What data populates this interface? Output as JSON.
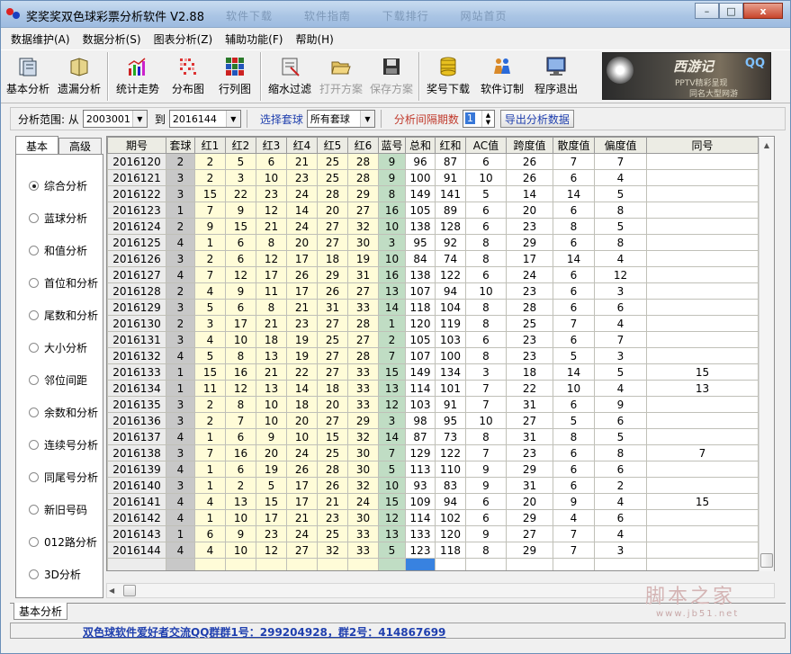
{
  "window": {
    "title": "奖奖奖双色球彩票分析软件 V2.88",
    "ghost_tabs": [
      "软件下载",
      "软件指南",
      "下载排行",
      "网站首页"
    ],
    "controls": {
      "minimize": "–",
      "maximize": "□",
      "close": "x"
    }
  },
  "menu": [
    "数据维护(A)",
    "数据分析(S)",
    "图表分析(Z)",
    "辅助功能(F)",
    "帮助(H)"
  ],
  "toolbar": {
    "groups": [
      [
        {
          "label": "基本分析",
          "icon": "basic-analysis-icon"
        },
        {
          "label": "遗漏分析",
          "icon": "omission-icon"
        }
      ],
      [
        {
          "label": "统计走势",
          "icon": "trend-chart-icon"
        },
        {
          "label": "分布图",
          "icon": "distribution-icon"
        },
        {
          "label": "行列图",
          "icon": "row-column-icon"
        }
      ],
      [
        {
          "label": "缩水过滤",
          "icon": "filter-icon"
        },
        {
          "label": "打开方案",
          "icon": "open-folder-icon",
          "disabled": true
        },
        {
          "label": "保存方案",
          "icon": "floppy-disk-icon",
          "disabled": true
        }
      ],
      [
        {
          "label": "奖号下载",
          "icon": "coin-stack-icon"
        },
        {
          "label": "软件订制",
          "icon": "people-icon"
        },
        {
          "label": "程序退出",
          "icon": "monitor-exit-icon"
        }
      ]
    ],
    "banner": {
      "title": "西游记",
      "qq": "QQ",
      "line1": "PPTV精彩呈现",
      "line2": "同名大型网游"
    }
  },
  "filter": {
    "range_label": "分析范围: 从",
    "from": "2003001",
    "to_label": "到",
    "to": "2016144",
    "select_label": "选择套球",
    "select_value": "所有套球",
    "interval_label": "分析间隔期数",
    "interval_value": "1",
    "export_label": "导出分析数据"
  },
  "left_tabs": [
    "基本",
    "高级"
  ],
  "analysis_options": [
    {
      "label": "综合分析",
      "selected": true
    },
    {
      "label": "蓝球分析",
      "selected": false
    },
    {
      "label": "和值分析",
      "selected": false
    },
    {
      "label": "首位和分析",
      "selected": false
    },
    {
      "label": "尾数和分析",
      "selected": false
    },
    {
      "label": "大小分析",
      "selected": false
    },
    {
      "label": "邻位间距",
      "selected": false
    },
    {
      "label": "余数和分析",
      "selected": false
    },
    {
      "label": "连续号分析",
      "selected": false
    },
    {
      "label": "同尾号分析",
      "selected": false
    },
    {
      "label": "新旧号码",
      "selected": false
    },
    {
      "label": "012路分析",
      "selected": false
    },
    {
      "label": "3D分析",
      "selected": false
    }
  ],
  "table": {
    "columns": [
      "期号",
      "套球",
      "红1",
      "红2",
      "红3",
      "红4",
      "红5",
      "红6",
      "蓝号",
      "总和",
      "红和",
      "AC值",
      "跨度值",
      "散度值",
      "偏度值",
      "同号"
    ],
    "rows": [
      [
        "2016120",
        "2",
        "2",
        "5",
        "6",
        "21",
        "25",
        "28",
        "9",
        "96",
        "87",
        "6",
        "26",
        "7",
        "7",
        ""
      ],
      [
        "2016121",
        "3",
        "2",
        "3",
        "10",
        "23",
        "25",
        "28",
        "9",
        "100",
        "91",
        "10",
        "26",
        "6",
        "4",
        ""
      ],
      [
        "2016122",
        "3",
        "15",
        "22",
        "23",
        "24",
        "28",
        "29",
        "8",
        "149",
        "141",
        "5",
        "14",
        "14",
        "5",
        ""
      ],
      [
        "2016123",
        "1",
        "7",
        "9",
        "12",
        "14",
        "20",
        "27",
        "16",
        "105",
        "89",
        "6",
        "20",
        "6",
        "8",
        ""
      ],
      [
        "2016124",
        "2",
        "9",
        "15",
        "21",
        "24",
        "27",
        "32",
        "10",
        "138",
        "128",
        "6",
        "23",
        "8",
        "5",
        ""
      ],
      [
        "2016125",
        "4",
        "1",
        "6",
        "8",
        "20",
        "27",
        "30",
        "3",
        "95",
        "92",
        "8",
        "29",
        "6",
        "8",
        ""
      ],
      [
        "2016126",
        "3",
        "2",
        "6",
        "12",
        "17",
        "18",
        "19",
        "10",
        "84",
        "74",
        "8",
        "17",
        "14",
        "4",
        ""
      ],
      [
        "2016127",
        "4",
        "7",
        "12",
        "17",
        "26",
        "29",
        "31",
        "16",
        "138",
        "122",
        "6",
        "24",
        "6",
        "12",
        ""
      ],
      [
        "2016128",
        "2",
        "4",
        "9",
        "11",
        "17",
        "26",
        "27",
        "13",
        "107",
        "94",
        "10",
        "23",
        "6",
        "3",
        ""
      ],
      [
        "2016129",
        "3",
        "5",
        "6",
        "8",
        "21",
        "31",
        "33",
        "14",
        "118",
        "104",
        "8",
        "28",
        "6",
        "6",
        ""
      ],
      [
        "2016130",
        "2",
        "3",
        "17",
        "21",
        "23",
        "27",
        "28",
        "1",
        "120",
        "119",
        "8",
        "25",
        "7",
        "4",
        ""
      ],
      [
        "2016131",
        "3",
        "4",
        "10",
        "18",
        "19",
        "25",
        "27",
        "2",
        "105",
        "103",
        "6",
        "23",
        "6",
        "7",
        ""
      ],
      [
        "2016132",
        "4",
        "5",
        "8",
        "13",
        "19",
        "27",
        "28",
        "7",
        "107",
        "100",
        "8",
        "23",
        "5",
        "3",
        ""
      ],
      [
        "2016133",
        "1",
        "15",
        "16",
        "21",
        "22",
        "27",
        "33",
        "15",
        "149",
        "134",
        "3",
        "18",
        "14",
        "5",
        "15"
      ],
      [
        "2016134",
        "1",
        "11",
        "12",
        "13",
        "14",
        "18",
        "33",
        "13",
        "114",
        "101",
        "7",
        "22",
        "10",
        "4",
        "13"
      ],
      [
        "2016135",
        "3",
        "2",
        "8",
        "10",
        "18",
        "20",
        "33",
        "12",
        "103",
        "91",
        "7",
        "31",
        "6",
        "9",
        ""
      ],
      [
        "2016136",
        "3",
        "2",
        "7",
        "10",
        "20",
        "27",
        "29",
        "3",
        "98",
        "95",
        "10",
        "27",
        "5",
        "6",
        ""
      ],
      [
        "2016137",
        "4",
        "1",
        "6",
        "9",
        "10",
        "15",
        "32",
        "14",
        "87",
        "73",
        "8",
        "31",
        "8",
        "5",
        ""
      ],
      [
        "2016138",
        "3",
        "7",
        "16",
        "20",
        "24",
        "25",
        "30",
        "7",
        "129",
        "122",
        "7",
        "23",
        "6",
        "8",
        "7"
      ],
      [
        "2016139",
        "4",
        "1",
        "6",
        "19",
        "26",
        "28",
        "30",
        "5",
        "113",
        "110",
        "9",
        "29",
        "6",
        "6",
        ""
      ],
      [
        "2016140",
        "3",
        "1",
        "2",
        "5",
        "17",
        "26",
        "32",
        "10",
        "93",
        "83",
        "9",
        "31",
        "6",
        "2",
        ""
      ],
      [
        "2016141",
        "4",
        "4",
        "13",
        "15",
        "17",
        "21",
        "24",
        "15",
        "109",
        "94",
        "6",
        "20",
        "9",
        "4",
        "15"
      ],
      [
        "2016142",
        "4",
        "1",
        "10",
        "17",
        "21",
        "23",
        "30",
        "12",
        "114",
        "102",
        "6",
        "29",
        "4",
        "6",
        ""
      ],
      [
        "2016143",
        "1",
        "6",
        "9",
        "23",
        "24",
        "25",
        "33",
        "13",
        "133",
        "120",
        "9",
        "27",
        "7",
        "4",
        ""
      ],
      [
        "2016144",
        "4",
        "4",
        "10",
        "12",
        "27",
        "32",
        "33",
        "5",
        "123",
        "118",
        "8",
        "29",
        "7",
        "3",
        ""
      ]
    ]
  },
  "bottom_tab": "基本分析",
  "status": "双色球软件爱好者交流QQ群群1号：299204928，群2号：414867699",
  "watermark": {
    "main": "脚本之家",
    "sub": "www.jb51.net"
  }
}
